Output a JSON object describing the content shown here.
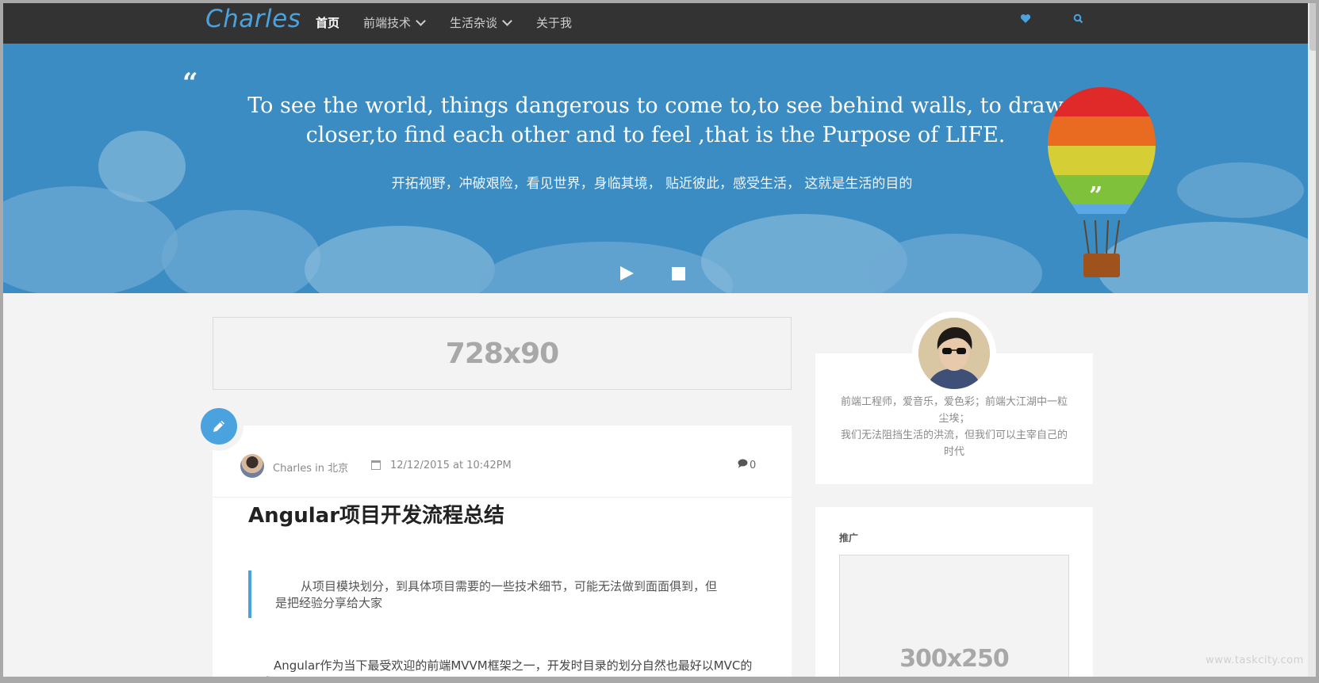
{
  "nav": {
    "logo": "Charles",
    "items": [
      {
        "label": "首页",
        "active": true
      },
      {
        "label": "前端技术",
        "has_dropdown": true
      },
      {
        "label": "生活杂谈",
        "has_dropdown": true
      },
      {
        "label": "关于我"
      }
    ],
    "icons": [
      "heart-icon",
      "search-icon"
    ]
  },
  "hero": {
    "quote_open": "“",
    "quote_close": "”",
    "quote_en": "To see the world, things dangerous to come to,to see behind walls, to draw closer,to find each other and to feel ,that is the Purpose of LIFE.",
    "quote_cn": "开拓视野，冲破艰险，看见世界，身临其境， 贴近彼此，感受生活， 这就是生活的目的",
    "controls": [
      "play-icon",
      "stop-icon"
    ],
    "balloon_colors": [
      "#e02a2a",
      "#e96b22",
      "#d5cf35",
      "#7fc13a",
      "#5aa8e6"
    ]
  },
  "ads": {
    "top_label": "728x90",
    "side_label": "300x250"
  },
  "post": {
    "author": "Charles in 北京",
    "date": "12/12/2015 at 10:42PM",
    "comments": "0",
    "title": "Angular项目开发流程总结",
    "blockquote": "从项目模块划分，到具体项目需要的一些技术细节，可能无法做到面面俱到，但是把经验分享给大家",
    "body": "Angular作为当下最受欢迎的前端MVVM框架之一，开发时目录的划分自然也最好以MVC的形式："
  },
  "sidebar": {
    "bio_line1": "前端工程师，爱音乐，爱色彩；前端大江湖中一粒尘埃；",
    "bio_line2": "我们无法阻挡生活的洪流，但我们可以主宰自己的时代",
    "promo_title": "推广"
  },
  "watermark": "www.taskcity.com",
  "colors": {
    "accent": "#4aa3df",
    "navbar": "#333333",
    "hero": "#3b8cc2"
  }
}
